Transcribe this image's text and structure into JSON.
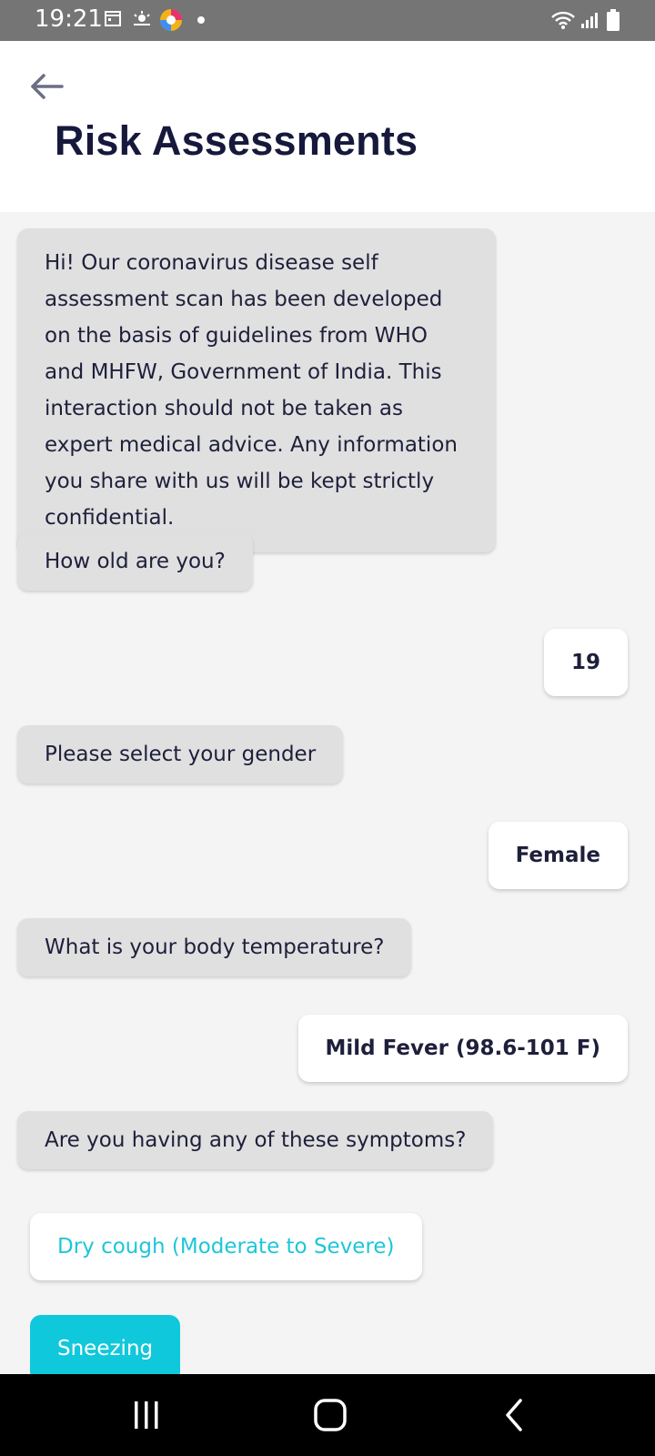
{
  "status_bar": {
    "time": "19:21",
    "icons": [
      "calendar-icon",
      "weather-icon",
      "browser-app-icon",
      "notification-dot",
      "wifi-icon",
      "signal-icon",
      "battery-icon"
    ]
  },
  "header": {
    "back_icon": "arrow-left-icon",
    "title": "Risk Assessments"
  },
  "chat": {
    "intro": "Hi! Our coronavirus disease self assessment scan has been developed on the basis of guidelines from WHO and MHFW, Government of India. This interaction should not be taken as expert medical advice. Any information you share with us will be kept strictly confidential.",
    "q_age": "How old are you?",
    "a_age": "19",
    "q_gender": "Please select your gender",
    "a_gender": "Female",
    "q_temp": "What is your body temperature?",
    "a_temp": "Mild Fever (98.6-101 F)",
    "q_symptoms": "Are you having any of these symptoms?",
    "options": [
      {
        "label": "Dry cough (Moderate to Severe)",
        "selected": false
      },
      {
        "label": "Sneezing",
        "selected": true
      }
    ]
  },
  "nav_bar": {
    "icons": [
      "recent-apps-icon",
      "home-icon",
      "back-nav-icon"
    ]
  },
  "colors": {
    "accent": "#0fc8db",
    "title": "#16193b",
    "bot_bubble": "#e0e0e0",
    "background": "#f4f4f4"
  }
}
